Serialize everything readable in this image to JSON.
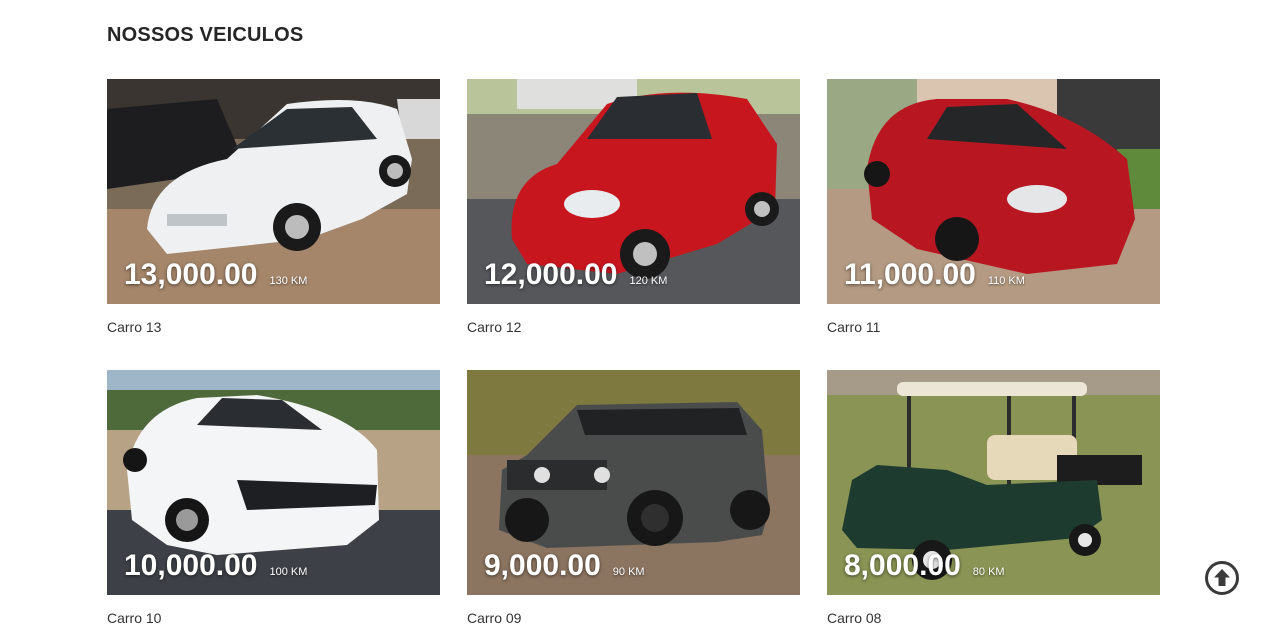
{
  "section": {
    "title": "NOSSOS VEICULOS"
  },
  "vehicles": [
    {
      "name": "Carro 13",
      "price": "13,000.00",
      "km": "130 KM",
      "image": "white-sedan",
      "color": "#eef0f1"
    },
    {
      "name": "Carro 12",
      "price": "12,000.00",
      "km": "120 KM",
      "image": "red-hatchback",
      "color": "#c8161f"
    },
    {
      "name": "Carro 11",
      "price": "11,000.00",
      "km": "110 KM",
      "image": "red-hatchback-kia",
      "color": "#b81722"
    },
    {
      "name": "Carro 10",
      "price": "10,000.00",
      "km": "100 KM",
      "image": "white-camaro",
      "color": "#f4f5f6"
    },
    {
      "name": "Carro 09",
      "price": "9,000.00",
      "km": "90 KM",
      "image": "gray-jeep",
      "color": "#4a4c4b"
    },
    {
      "name": "Carro 08",
      "price": "8,000.00",
      "km": "80 KM",
      "image": "golf-cart",
      "color": "#1e3b2f"
    }
  ],
  "back_to_top": {
    "icon": "arrow-up-circle-icon"
  }
}
